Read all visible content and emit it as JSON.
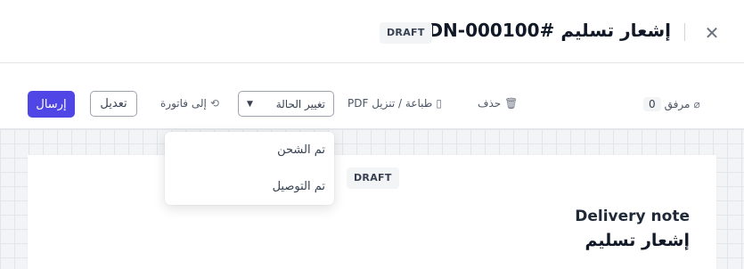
{
  "header": {
    "title": "إشعار تسليم #GDN-000100",
    "status_badge": "DRAFT",
    "close_icon": "close-icon"
  },
  "toolbar": {
    "attachments_label": "مرفق",
    "attachments_count": "0",
    "delete_label": "حذف",
    "print_label": "طباعة / تنزيل PDF",
    "status_select_value": "تغيير الحالة",
    "to_invoice_label": "إلى فاتورة",
    "edit_label": "تعديل",
    "send_label": "إرسال"
  },
  "status_menu": {
    "options": [
      "تم الشحن",
      "تم التوصيل"
    ]
  },
  "document": {
    "status_badge": "DRAFT",
    "heading_en": "Delivery note",
    "heading_ar": "إشعار تسليم"
  },
  "colors": {
    "primary": "#4f46e5",
    "badge_bg": "#f3f4f6"
  }
}
